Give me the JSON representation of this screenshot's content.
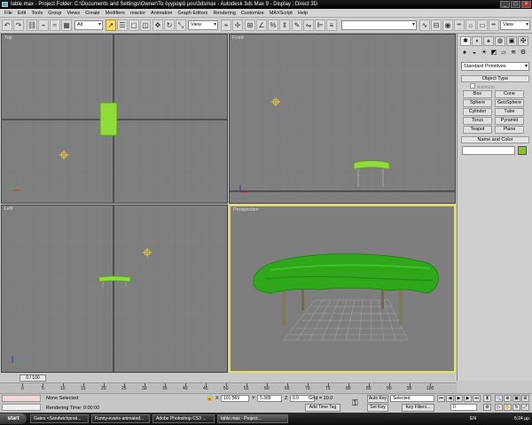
{
  "window": {
    "title": "table.max     - Project Folder: C:\\Documents and Settings\\Owner\\Τα έγγραφά μου\\3dsmax     - Autodesk 3ds Max 9     - Display : Direct 3D"
  },
  "menu": [
    "File",
    "Edit",
    "Tools",
    "Group",
    "Views",
    "Create",
    "Modifiers",
    "reactor",
    "Animation",
    "Graph Editors",
    "Rendering",
    "Customize",
    "MAXScript",
    "Help"
  ],
  "toolbar": {
    "filter_value": "All",
    "refcoord_value": "View",
    "right_view_value": "View"
  },
  "viewports": {
    "top_label": "Top",
    "front_label": "Front",
    "left_label": "Left",
    "perspective_label": "Perspective",
    "colors": {
      "object": "#8fdc3a",
      "persp_object": "#2ea81a",
      "grid": "#9a9a9a",
      "active_border": "#e8df5a"
    }
  },
  "command_panel": {
    "category_dropdown": "Standard Primitives",
    "object_type_header": "Object Type",
    "autogrid_label": "AutoGrid",
    "objects": [
      "Box",
      "Cone",
      "Sphere",
      "GeoSphere",
      "Cylinder",
      "Tube",
      "Torus",
      "Pyramid",
      "Teapot",
      "Plane"
    ],
    "name_color_header": "Name and Color"
  },
  "timeline": {
    "frame_readout": "0 / 100",
    "ticks": [
      "0",
      "5",
      "10",
      "15",
      "20",
      "25",
      "30",
      "35",
      "40",
      "45",
      "50",
      "55",
      "60",
      "65",
      "70",
      "75",
      "80",
      "85",
      "90",
      "95",
      "100"
    ]
  },
  "status": {
    "selection": "None Selected",
    "render_time": "Rendering Time: 0:00:00",
    "x_label": "X",
    "x_value": "101.569",
    "y_label": "Y",
    "y_value": "5.389",
    "z_label": "Z",
    "z_value": "0.0",
    "grid": "Grid = 10.0",
    "add_time_tag": "Add Time Tag",
    "auto_key": "Auto Key",
    "set_key": "Set Key",
    "selected_dropdown": "Selected",
    "key_filters": "Key Filters...",
    "current_frame": "0"
  },
  "taskbar": {
    "start": "start",
    "tasks": [
      "Gates <Sandwichprod...",
      "Funny-evans-animated...",
      "Adobe Photoshop CS3 ...",
      "table.max     - Project..."
    ],
    "lang": "EN",
    "clock": "5:24 μμ"
  }
}
